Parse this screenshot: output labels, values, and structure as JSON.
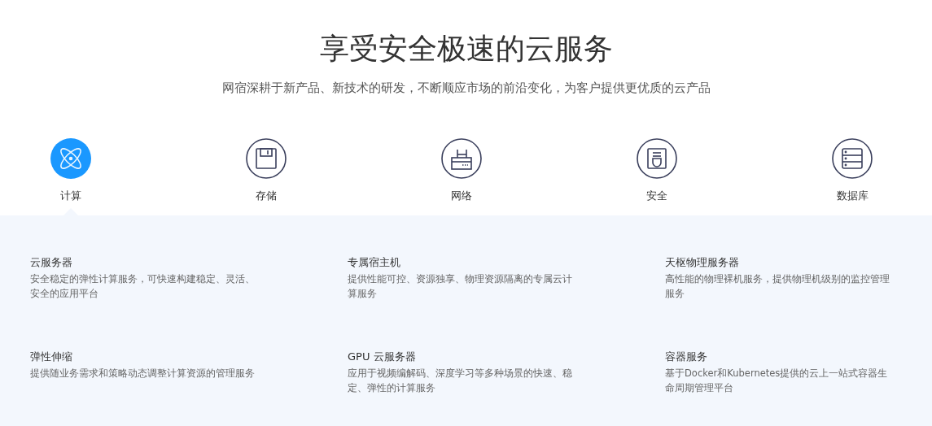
{
  "header": {
    "title": "享受安全极速的云服务",
    "subtitle": "网宿深耕于新产品、新技术的研发，不断顺应市场的前沿变化，为客户提供更优质的云产品"
  },
  "tabs": [
    {
      "label": "计算",
      "kind": "atom",
      "selected": true
    },
    {
      "label": "存储",
      "kind": "disk",
      "selected": false
    },
    {
      "label": "网络",
      "kind": "router",
      "selected": false
    },
    {
      "label": "安全",
      "kind": "shield",
      "selected": false
    },
    {
      "label": "数据库",
      "kind": "server",
      "selected": false
    }
  ],
  "products": [
    {
      "name": "云服务器",
      "description": "安全稳定的弹性计算服务，可快速构建稳定、灵活、安全的应用平台"
    },
    {
      "name": "专属宿主机",
      "description": "提供性能可控、资源独享、物理资源隔离的专属云计算服务"
    },
    {
      "name": "天枢物理服务器",
      "description": "高性能的物理裸机服务，提供物理机级别的监控管理服务"
    },
    {
      "name": "弹性伸缩",
      "description": "提供随业务需求和策略动态调整计算资源的管理服务"
    },
    {
      "name": "GPU 云服务器",
      "description": "应用于视频编解码、深度学习等多种场景的快速、稳定、弹性的计算服务"
    },
    {
      "name": "容器服务",
      "description": "基于Docker和Kubernetes提供的云上一站式容器生命周期管理平台"
    }
  ]
}
